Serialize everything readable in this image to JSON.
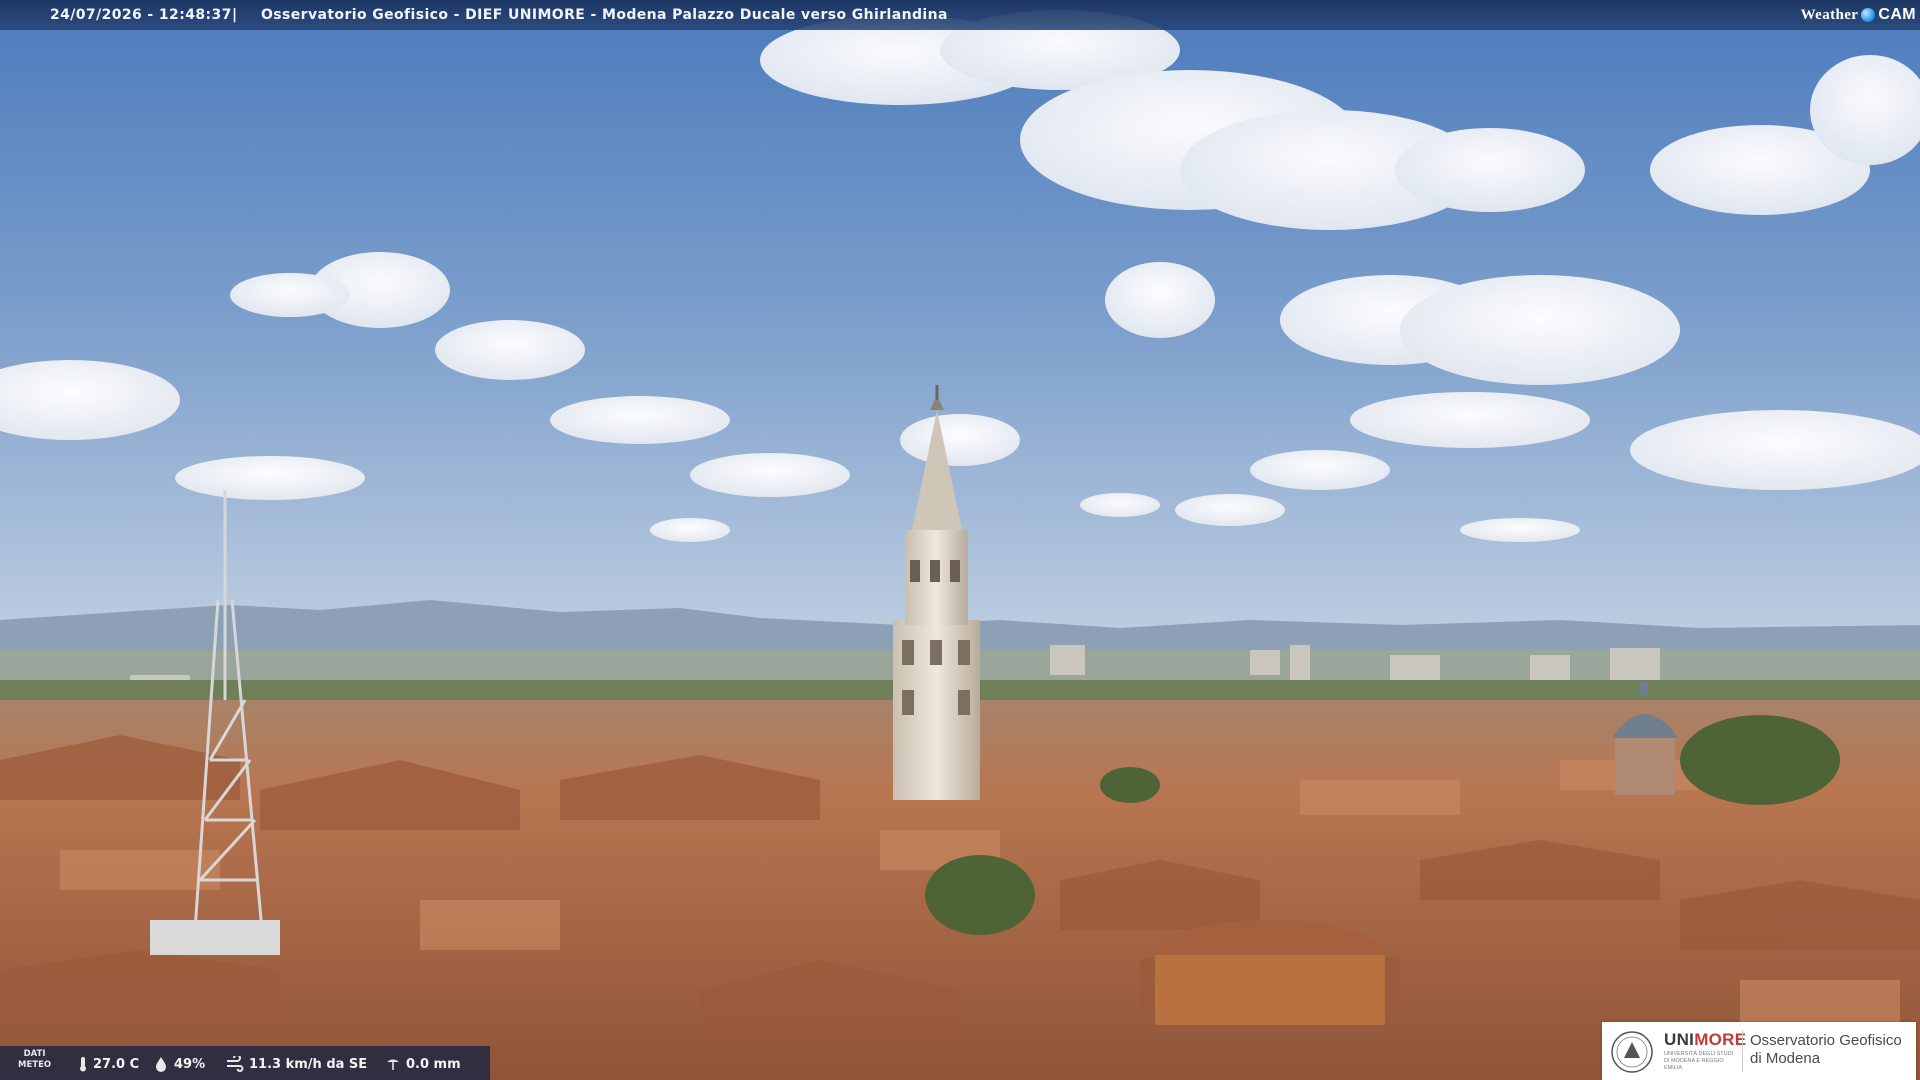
{
  "header": {
    "timestamp": "24/07/2026 - 12:48:37",
    "separator": "|",
    "title": "Osservatorio Geofisico - DIEF UNIMORE - Modena Palazzo Ducale verso Ghirlandina",
    "brand_weather": "Weather",
    "brand_cam": "CAM"
  },
  "meteo": {
    "label_line1": "DATI",
    "label_line2": "METEO",
    "temperature": "27.0 C",
    "humidity": "49%",
    "wind": "11.3 km/h da SE",
    "rain": "0.0 mm"
  },
  "logo": {
    "uni_prefix": "UNI",
    "uni_suffix": "MORE",
    "uni_subtitle": "Università degli Studi di Modena e Reggio Emilia",
    "observatory_line1": "Osservatorio Geofisico",
    "observatory_line2": "di Modena"
  },
  "icons": [
    "thermometer-icon",
    "humidity-drop-icon",
    "wind-icon",
    "rain-gauge-icon",
    "unimore-seal-icon",
    "weathercam-drop-icon"
  ],
  "colors": {
    "sky_top": "#4f7fbe",
    "sky_bottom": "#b9cbe0",
    "roof": "#b5714a",
    "tower": "#e6ddd0",
    "accent_red": "#c23a36"
  }
}
